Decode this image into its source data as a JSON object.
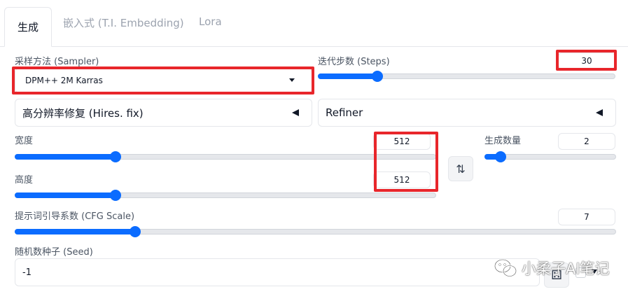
{
  "tabs": [
    {
      "label": "生成",
      "active": true
    },
    {
      "label": "嵌入式 (T.I. Embedding)",
      "active": false
    },
    {
      "label": "Lora",
      "active": false
    }
  ],
  "sampler": {
    "label": "采样方法 (Sampler)",
    "value": "DPM++ 2M Karras"
  },
  "steps": {
    "label": "迭代步数 (Steps)",
    "value": "30",
    "fraction": 0.2
  },
  "hires": {
    "label": "高分辨率修复 (Hires. fix)"
  },
  "refiner": {
    "label": "Refiner"
  },
  "width": {
    "label": "宽度",
    "value": "512",
    "fraction": 0.24
  },
  "height": {
    "label": "高度",
    "value": "512",
    "fraction": 0.24
  },
  "batch": {
    "label": "生成数量",
    "value": "2",
    "fraction": 0.12
  },
  "cfg": {
    "label": "提示词引导系数 (CFG Scale)",
    "value": "7",
    "fraction": 0.2
  },
  "seed": {
    "label": "随机数种子 (Seed)",
    "value": "-1"
  },
  "icons": {
    "swap": "swap-arrows-icon",
    "dice": "dice-icon",
    "wechat": "wechat-logo-icon"
  },
  "colors": {
    "accent": "#0b6cff",
    "highlight": "#e8262b"
  },
  "watermark": {
    "text": "小柔子AI笔记"
  }
}
